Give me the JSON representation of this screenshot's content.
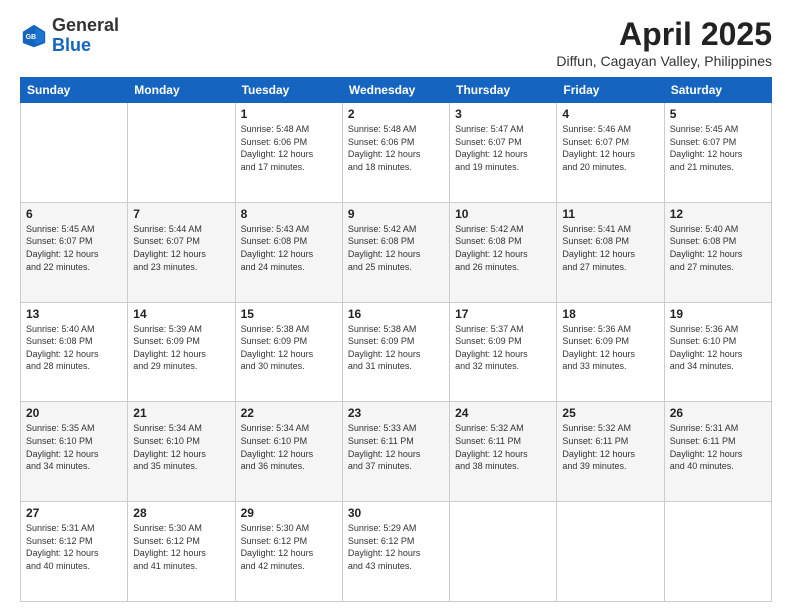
{
  "header": {
    "logo_general": "General",
    "logo_blue": "Blue",
    "month_title": "April 2025",
    "location": "Diffun, Cagayan Valley, Philippines"
  },
  "weekdays": [
    "Sunday",
    "Monday",
    "Tuesday",
    "Wednesday",
    "Thursday",
    "Friday",
    "Saturday"
  ],
  "weeks": [
    [
      {
        "day": "",
        "detail": ""
      },
      {
        "day": "",
        "detail": ""
      },
      {
        "day": "1",
        "detail": "Sunrise: 5:48 AM\nSunset: 6:06 PM\nDaylight: 12 hours\nand 17 minutes."
      },
      {
        "day": "2",
        "detail": "Sunrise: 5:48 AM\nSunset: 6:06 PM\nDaylight: 12 hours\nand 18 minutes."
      },
      {
        "day": "3",
        "detail": "Sunrise: 5:47 AM\nSunset: 6:07 PM\nDaylight: 12 hours\nand 19 minutes."
      },
      {
        "day": "4",
        "detail": "Sunrise: 5:46 AM\nSunset: 6:07 PM\nDaylight: 12 hours\nand 20 minutes."
      },
      {
        "day": "5",
        "detail": "Sunrise: 5:45 AM\nSunset: 6:07 PM\nDaylight: 12 hours\nand 21 minutes."
      }
    ],
    [
      {
        "day": "6",
        "detail": "Sunrise: 5:45 AM\nSunset: 6:07 PM\nDaylight: 12 hours\nand 22 minutes."
      },
      {
        "day": "7",
        "detail": "Sunrise: 5:44 AM\nSunset: 6:07 PM\nDaylight: 12 hours\nand 23 minutes."
      },
      {
        "day": "8",
        "detail": "Sunrise: 5:43 AM\nSunset: 6:08 PM\nDaylight: 12 hours\nand 24 minutes."
      },
      {
        "day": "9",
        "detail": "Sunrise: 5:42 AM\nSunset: 6:08 PM\nDaylight: 12 hours\nand 25 minutes."
      },
      {
        "day": "10",
        "detail": "Sunrise: 5:42 AM\nSunset: 6:08 PM\nDaylight: 12 hours\nand 26 minutes."
      },
      {
        "day": "11",
        "detail": "Sunrise: 5:41 AM\nSunset: 6:08 PM\nDaylight: 12 hours\nand 27 minutes."
      },
      {
        "day": "12",
        "detail": "Sunrise: 5:40 AM\nSunset: 6:08 PM\nDaylight: 12 hours\nand 27 minutes."
      }
    ],
    [
      {
        "day": "13",
        "detail": "Sunrise: 5:40 AM\nSunset: 6:08 PM\nDaylight: 12 hours\nand 28 minutes."
      },
      {
        "day": "14",
        "detail": "Sunrise: 5:39 AM\nSunset: 6:09 PM\nDaylight: 12 hours\nand 29 minutes."
      },
      {
        "day": "15",
        "detail": "Sunrise: 5:38 AM\nSunset: 6:09 PM\nDaylight: 12 hours\nand 30 minutes."
      },
      {
        "day": "16",
        "detail": "Sunrise: 5:38 AM\nSunset: 6:09 PM\nDaylight: 12 hours\nand 31 minutes."
      },
      {
        "day": "17",
        "detail": "Sunrise: 5:37 AM\nSunset: 6:09 PM\nDaylight: 12 hours\nand 32 minutes."
      },
      {
        "day": "18",
        "detail": "Sunrise: 5:36 AM\nSunset: 6:09 PM\nDaylight: 12 hours\nand 33 minutes."
      },
      {
        "day": "19",
        "detail": "Sunrise: 5:36 AM\nSunset: 6:10 PM\nDaylight: 12 hours\nand 34 minutes."
      }
    ],
    [
      {
        "day": "20",
        "detail": "Sunrise: 5:35 AM\nSunset: 6:10 PM\nDaylight: 12 hours\nand 34 minutes."
      },
      {
        "day": "21",
        "detail": "Sunrise: 5:34 AM\nSunset: 6:10 PM\nDaylight: 12 hours\nand 35 minutes."
      },
      {
        "day": "22",
        "detail": "Sunrise: 5:34 AM\nSunset: 6:10 PM\nDaylight: 12 hours\nand 36 minutes."
      },
      {
        "day": "23",
        "detail": "Sunrise: 5:33 AM\nSunset: 6:11 PM\nDaylight: 12 hours\nand 37 minutes."
      },
      {
        "day": "24",
        "detail": "Sunrise: 5:32 AM\nSunset: 6:11 PM\nDaylight: 12 hours\nand 38 minutes."
      },
      {
        "day": "25",
        "detail": "Sunrise: 5:32 AM\nSunset: 6:11 PM\nDaylight: 12 hours\nand 39 minutes."
      },
      {
        "day": "26",
        "detail": "Sunrise: 5:31 AM\nSunset: 6:11 PM\nDaylight: 12 hours\nand 40 minutes."
      }
    ],
    [
      {
        "day": "27",
        "detail": "Sunrise: 5:31 AM\nSunset: 6:12 PM\nDaylight: 12 hours\nand 40 minutes."
      },
      {
        "day": "28",
        "detail": "Sunrise: 5:30 AM\nSunset: 6:12 PM\nDaylight: 12 hours\nand 41 minutes."
      },
      {
        "day": "29",
        "detail": "Sunrise: 5:30 AM\nSunset: 6:12 PM\nDaylight: 12 hours\nand 42 minutes."
      },
      {
        "day": "30",
        "detail": "Sunrise: 5:29 AM\nSunset: 6:12 PM\nDaylight: 12 hours\nand 43 minutes."
      },
      {
        "day": "",
        "detail": ""
      },
      {
        "day": "",
        "detail": ""
      },
      {
        "day": "",
        "detail": ""
      }
    ]
  ]
}
